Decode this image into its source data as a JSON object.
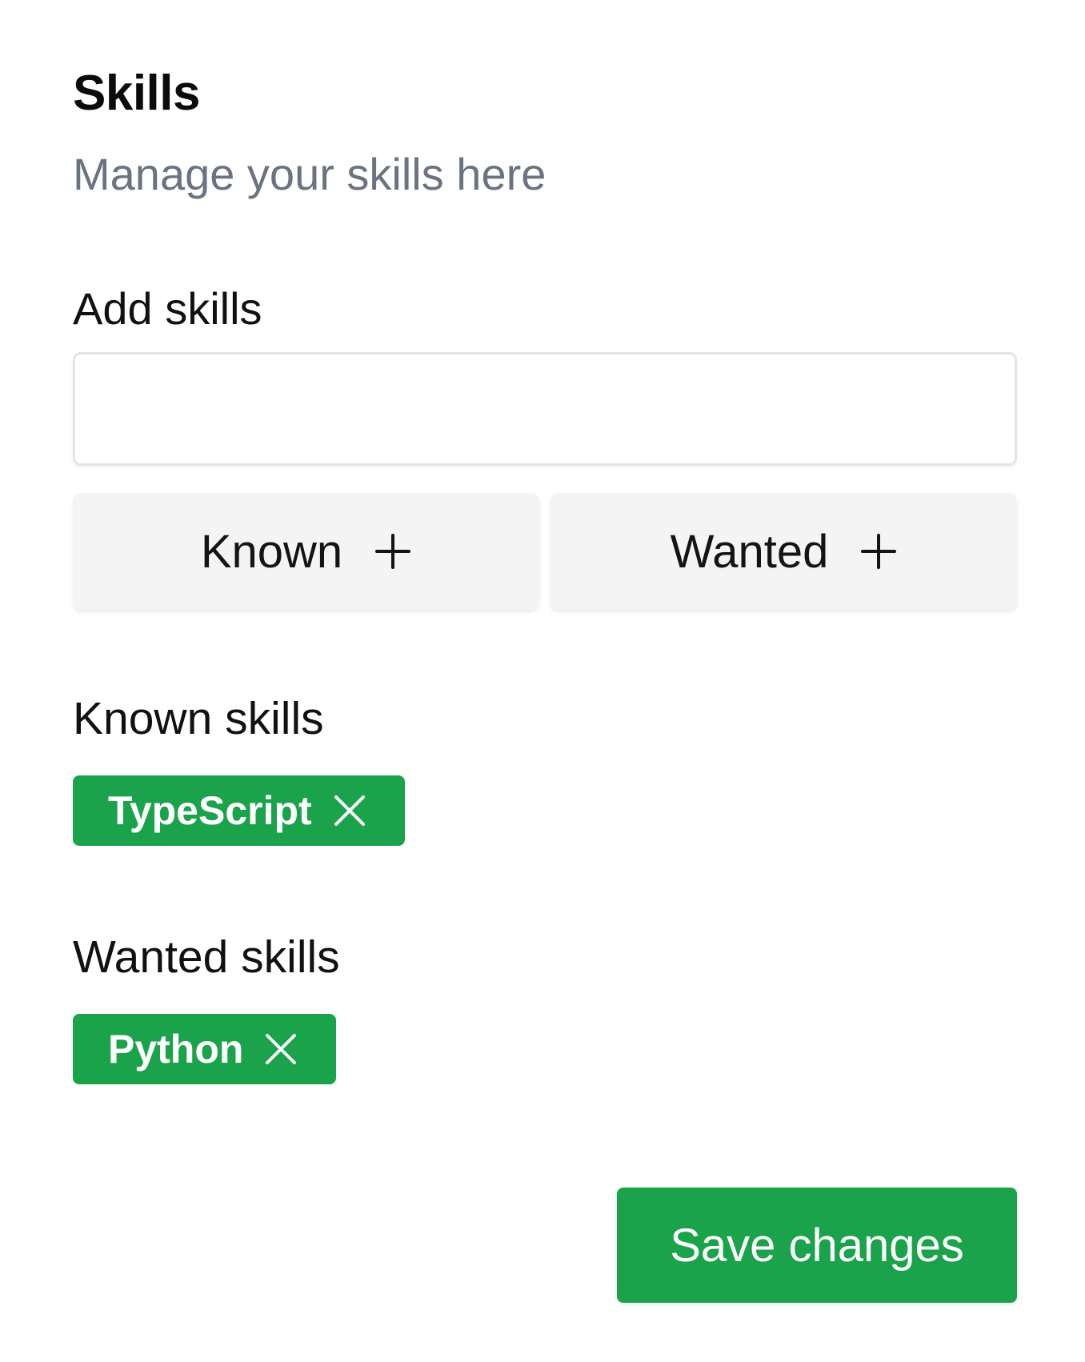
{
  "header": {
    "title": "Skills",
    "subtitle": "Manage your skills here"
  },
  "add_skills": {
    "label": "Add skills",
    "input_value": "",
    "known_button_label": "Known",
    "wanted_button_label": "Wanted",
    "button_icon": "plus-icon"
  },
  "known_skills": {
    "heading": "Known skills",
    "tags": [
      {
        "label": "TypeScript",
        "icon": "close-icon"
      }
    ]
  },
  "wanted_skills": {
    "heading": "Wanted skills",
    "tags": [
      {
        "label": "Python",
        "icon": "close-icon"
      }
    ]
  },
  "footer": {
    "save_label": "Save changes"
  },
  "colors": {
    "accent_green": "#1aa34a",
    "secondary_button_bg": "#f4f4f4",
    "muted_text": "#6b7280"
  }
}
